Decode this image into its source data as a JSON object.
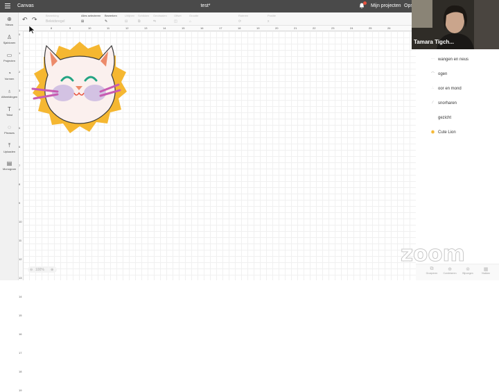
{
  "topbar": {
    "app_title": "Canvas",
    "doc_title": "test*",
    "my_projects": "Mijn projecten",
    "save_label": "Ops"
  },
  "toolbar": {
    "groups": [
      {
        "title": "Bewerking",
        "sub": "Beleidsregel"
      },
      {
        "title": "Alles selecteren",
        "sub": ""
      },
      {
        "title": "Bewerken",
        "sub": ""
      },
      {
        "title": "Uitlijnen",
        "sub": ""
      },
      {
        "title": "Schikken",
        "sub": ""
      },
      {
        "title": "Omdraaien",
        "sub": ""
      },
      {
        "title": "Offset",
        "sub": ""
      },
      {
        "title": "Grootte",
        "sub": ""
      },
      {
        "title": "Roteren",
        "sub": ""
      },
      {
        "title": "Positie",
        "sub": ""
      }
    ]
  },
  "sidebar": {
    "items": [
      {
        "label": "Nieuw",
        "icon": "plus-icon"
      },
      {
        "label": "Sjablonen",
        "icon": "shirt-icon"
      },
      {
        "label": "Projecten",
        "icon": "folder-icon"
      },
      {
        "label": "Vormen",
        "icon": "shapes-icon"
      },
      {
        "label": "Afbeeldingen",
        "icon": "bulb-icon"
      },
      {
        "label": "Tekst",
        "icon": "text-icon"
      },
      {
        "label": "Phrases",
        "icon": "speech-icon"
      },
      {
        "label": "Uploaden",
        "icon": "upload-icon"
      },
      {
        "label": "Monogram",
        "icon": "monogram-icon"
      }
    ]
  },
  "ruler": {
    "top": [
      "8",
      "9",
      "10",
      "11",
      "12",
      "13",
      "14",
      "15",
      "16",
      "17",
      "18",
      "19",
      "20",
      "21",
      "22",
      "23",
      "24",
      "25",
      "26"
    ],
    "left": [
      "0",
      "1",
      "2",
      "3",
      "4",
      "5",
      "6",
      "7",
      "8",
      "9",
      "10",
      "11",
      "12",
      "13",
      "14",
      "15",
      "16",
      "17",
      "18",
      "19"
    ]
  },
  "zoom_level": "100%",
  "participant": {
    "name": "Tamara Tigch..."
  },
  "layers": [
    {
      "label": "wangen en neus",
      "swatch": "lines"
    },
    {
      "label": "ogen",
      "swatch": "arcs"
    },
    {
      "label": "oor en mond",
      "swatch": "dots"
    },
    {
      "label": "snorharen",
      "swatch": "slash"
    },
    {
      "label": "gezicht",
      "swatch": "blank"
    },
    {
      "label": "Cute Lion",
      "swatch": "lion"
    }
  ],
  "zoom_watermark": "zoom",
  "bottom_bar": [
    {
      "label": "Groeperen"
    },
    {
      "label": "Combineren"
    },
    {
      "label": "Bijvoegen"
    },
    {
      "label": "Vlakken"
    }
  ],
  "colors": {
    "topbar": "#4a4a4a",
    "mane": "#f5b731",
    "face": "#fbf0ee",
    "cheeks": "#d3c2e3",
    "whiskers": "#c85bb1",
    "outline": "#3a3a3a"
  }
}
